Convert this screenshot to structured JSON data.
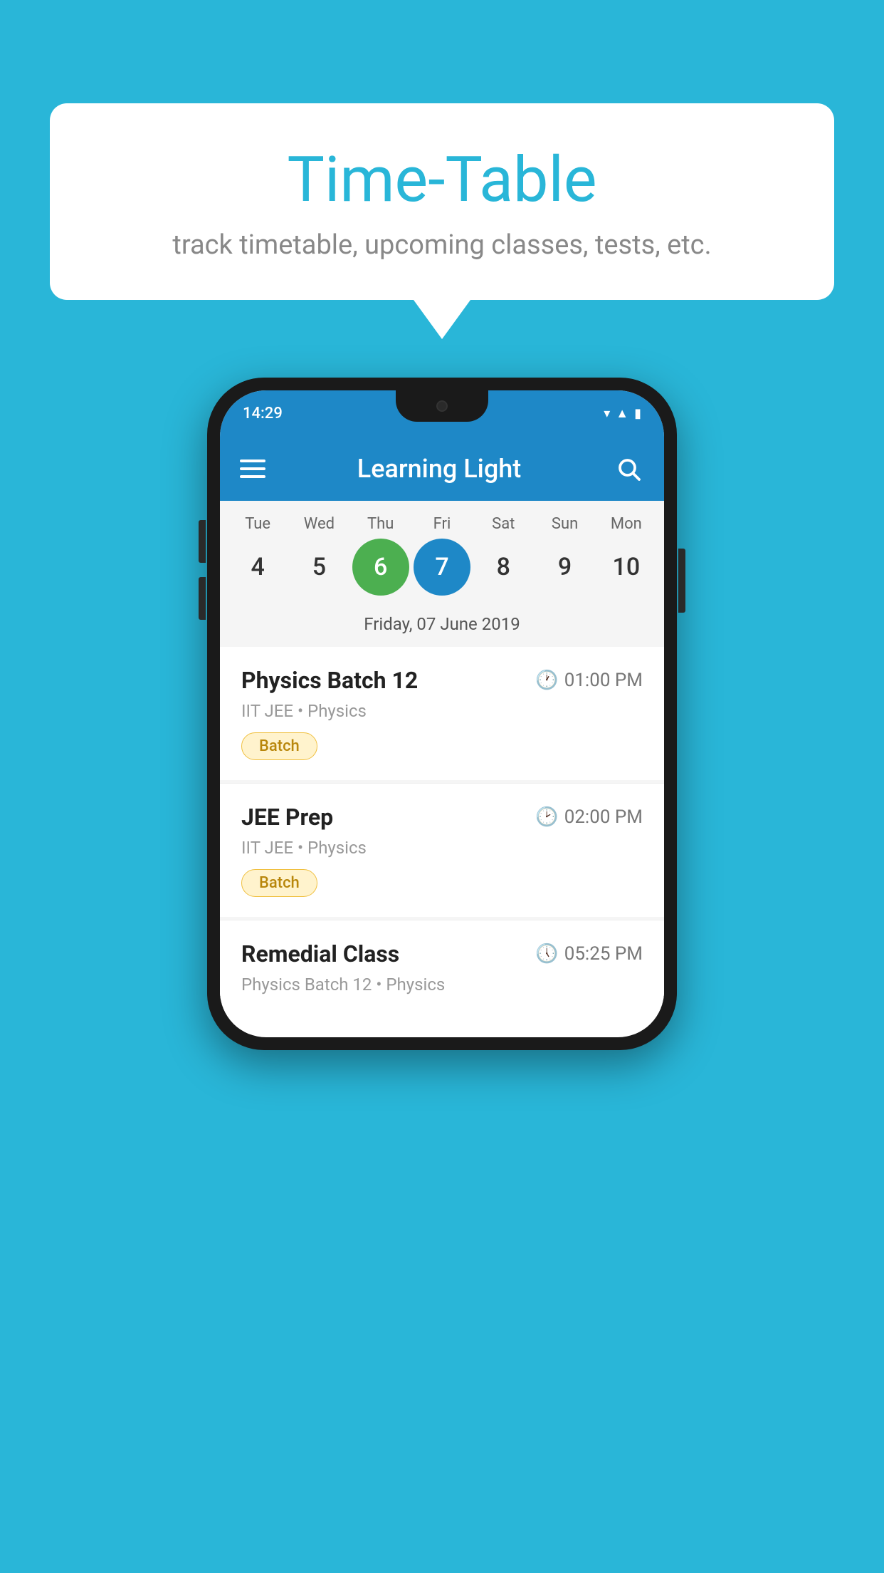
{
  "background": {
    "color": "#29b6d8"
  },
  "speech_bubble": {
    "title": "Time-Table",
    "subtitle": "track timetable, upcoming classes, tests, etc."
  },
  "phone": {
    "status_bar": {
      "time": "14:29"
    },
    "app_bar": {
      "title": "Learning Light",
      "menu_icon": "hamburger-icon",
      "search_icon": "search-icon"
    },
    "calendar": {
      "days": [
        {
          "label": "Tue",
          "number": "4"
        },
        {
          "label": "Wed",
          "number": "5"
        },
        {
          "label": "Thu",
          "number": "6",
          "state": "today"
        },
        {
          "label": "Fri",
          "number": "7",
          "state": "selected"
        },
        {
          "label": "Sat",
          "number": "8"
        },
        {
          "label": "Sun",
          "number": "9"
        },
        {
          "label": "Mon",
          "number": "10"
        }
      ],
      "selected_date_label": "Friday, 07 June 2019"
    },
    "schedule": [
      {
        "title": "Physics Batch 12",
        "time": "01:00 PM",
        "subtitle": "IIT JEE • Physics",
        "badge": "Batch"
      },
      {
        "title": "JEE Prep",
        "time": "02:00 PM",
        "subtitle": "IIT JEE • Physics",
        "badge": "Batch"
      },
      {
        "title": "Remedial Class",
        "time": "05:25 PM",
        "subtitle": "Physics Batch 12 • Physics",
        "badge": null
      }
    ]
  }
}
